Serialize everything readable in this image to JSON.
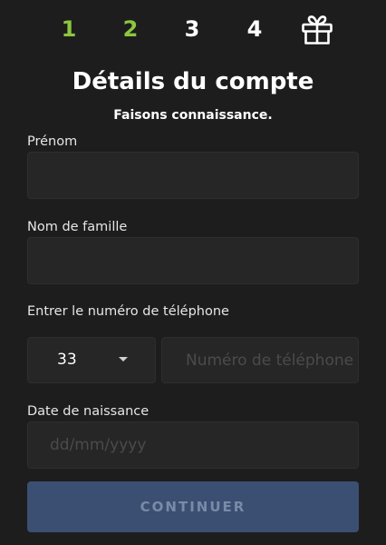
{
  "stepper": {
    "steps": [
      "1",
      "2",
      "3",
      "4"
    ],
    "gift_icon": "gift-icon",
    "done_color": "#8cc63f",
    "todo_color": "#ffffff"
  },
  "header": {
    "title": "Détails du compte",
    "subtitle": "Faisons connaissance."
  },
  "form": {
    "first_name": {
      "label": "Prénom",
      "value": "",
      "placeholder": ""
    },
    "last_name": {
      "label": "Nom de famille",
      "value": "",
      "placeholder": ""
    },
    "phone": {
      "label": "Entrer le numéro de téléphone",
      "country_code": "33",
      "value": "",
      "placeholder": "Numéro de téléphone"
    },
    "birth_date": {
      "label": "Date de naissance",
      "value": "",
      "placeholder": "dd/mm/yyyy"
    }
  },
  "actions": {
    "continue_label": "CONTINUER",
    "button_color": "#3b4f72"
  }
}
